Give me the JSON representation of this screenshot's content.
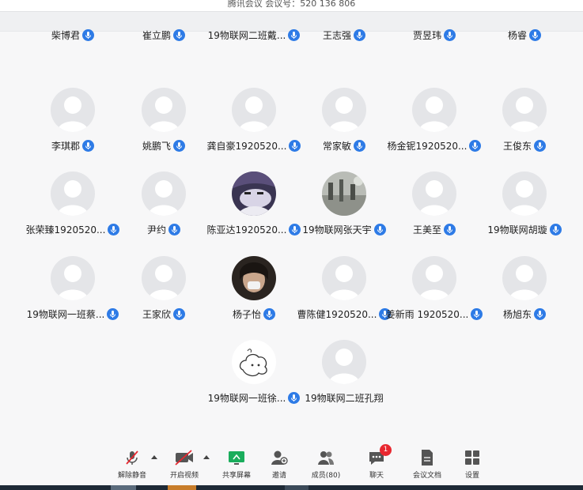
{
  "header": {
    "title": "腾讯会议 会议号：520 136 806"
  },
  "participants": [
    {
      "name": "柴博君"
    },
    {
      "name": "崔立鹏"
    },
    {
      "name": "19物联网二班戴..."
    },
    {
      "name": "王志强"
    },
    {
      "name": "贾昱玮"
    },
    {
      "name": "杨睿"
    },
    {
      "name": "李琪郡"
    },
    {
      "name": "姚鹏飞"
    },
    {
      "name": "龚自豪1920520..."
    },
    {
      "name": "常家敏"
    },
    {
      "name": "杨金铌1920520..."
    },
    {
      "name": "王俊东"
    },
    {
      "name": "张荣臻1920520..."
    },
    {
      "name": "尹约"
    },
    {
      "name": "陈亚达1920520..."
    },
    {
      "name": "19物联网张天宇"
    },
    {
      "name": "王美至"
    },
    {
      "name": "19物联网胡璇"
    },
    {
      "name": "19物联网一班蔡..."
    },
    {
      "name": "王家欣"
    },
    {
      "name": "杨子怡"
    },
    {
      "name": "曹陈健1920520..."
    },
    {
      "name": "姜新雨 1920520..."
    },
    {
      "name": "杨旭东"
    },
    {
      "name": "19物联网一班徐..."
    },
    {
      "name": "19物联网二班孔翔"
    }
  ],
  "toolbar": {
    "unmute": "解除静音",
    "start_video": "开启视频",
    "share_screen": "共享屏幕",
    "invite": "邀请",
    "members": "成员(80)",
    "chat": "聊天",
    "chat_badge": "1",
    "docs": "会议文档",
    "settings": "设置"
  },
  "colors": {
    "accent": "#2e7be6",
    "badge": "#e8272f",
    "share": "#1aad5c"
  }
}
